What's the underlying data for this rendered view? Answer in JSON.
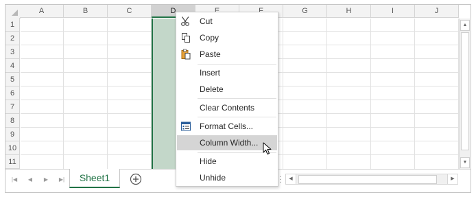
{
  "columns": [
    "A",
    "B",
    "C",
    "D",
    "E",
    "F",
    "G",
    "H",
    "I",
    "J"
  ],
  "selected_column": "D",
  "rows": [
    "1",
    "2",
    "3",
    "4",
    "5",
    "6",
    "7",
    "8",
    "9",
    "10",
    "11"
  ],
  "context_menu": {
    "items": [
      {
        "label": "Cut",
        "icon": "scissors-icon"
      },
      {
        "label": "Copy",
        "icon": "copy-icon"
      },
      {
        "label": "Paste",
        "icon": "paste-icon"
      },
      {
        "label": "Insert",
        "icon": ""
      },
      {
        "label": "Delete",
        "icon": ""
      },
      {
        "label": "Clear Contents",
        "icon": ""
      },
      {
        "label": "Format Cells...",
        "icon": "format-cells-icon"
      },
      {
        "label": "Column Width...",
        "icon": "",
        "highlighted": true
      },
      {
        "label": "Hide",
        "icon": ""
      },
      {
        "label": "Unhide",
        "icon": ""
      }
    ]
  },
  "sheet_tabs": {
    "active": "Sheet1",
    "add_icon": "plus-circle-icon",
    "nav_icons": [
      "first-sheet-icon",
      "prev-sheet-icon",
      "next-sheet-icon",
      "last-sheet-icon"
    ]
  },
  "colors": {
    "accent": "#217346",
    "selection_fill": "#c3d7c9",
    "menu_hover": "#d5d5d5"
  }
}
